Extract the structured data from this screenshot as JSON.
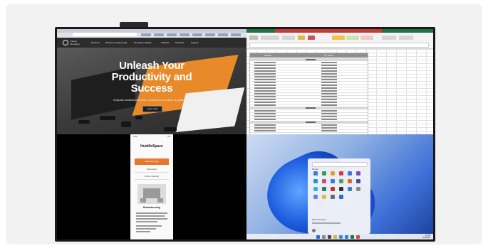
{
  "website": {
    "hero_title_line1": "Unleash Your",
    "hero_title_line2": "Productivity and",
    "hero_title_line3": "Success",
    "hero_subtitle": "Empower businesses to thrive, connect you to a world of possibilities.",
    "hero_button": "Learn more",
    "brand_text": "Yuanjie Innovation",
    "nav_items": [
      "Products",
      "Wireless Conferencing",
      "Interactive Display",
      "Software",
      "Solutions",
      "Support"
    ]
  },
  "spreadsheet": {
    "header_left": "Module",
    "header_right": "XT Series"
  },
  "mobile": {
    "time": "9:41",
    "signal": "5G",
    "title": "HuddleSpace",
    "primary_button": "Brainstorming",
    "items": [
      "Discussion",
      "Online Meeting"
    ],
    "caption": "Brainstorming"
  },
  "desktop": {
    "pinned_label": "Pinned",
    "recommended_label": "Recommended",
    "clock_time": "10:30",
    "clock_date": "2023/8/1"
  },
  "colors": {
    "orange_accent": "#e88a2a",
    "excel_green": "#1f7244",
    "win_blue": "#1f5fe0"
  }
}
